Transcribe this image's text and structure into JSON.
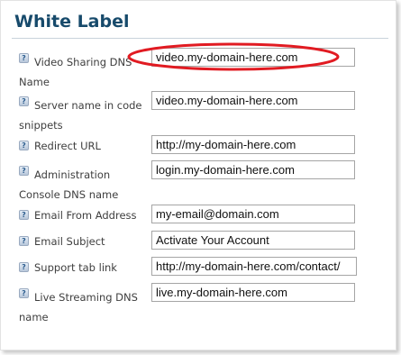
{
  "title": "White Label",
  "help_glyph": "?",
  "fields": [
    {
      "label": "Video Sharing DNS Name",
      "value": "video.my-domain-here.com"
    },
    {
      "label": "Server name in code snippets",
      "value": "video.my-domain-here.com"
    },
    {
      "label": "Redirect URL",
      "value": "http://my-domain-here.com"
    },
    {
      "label": "Administration Console DNS name",
      "value": "login.my-domain-here.com"
    },
    {
      "label": "Email From Address",
      "value": "my-email@domain.com"
    },
    {
      "label": "Email Subject",
      "value": "Activate Your Account"
    },
    {
      "label": "Support tab link",
      "value": "http://my-domain-here.com/contact/"
    },
    {
      "label": "Live Streaming DNS name",
      "value": "live.my-domain-here.com"
    }
  ],
  "colors": {
    "title": "#174a6b",
    "highlight_ring": "#e11b22"
  }
}
